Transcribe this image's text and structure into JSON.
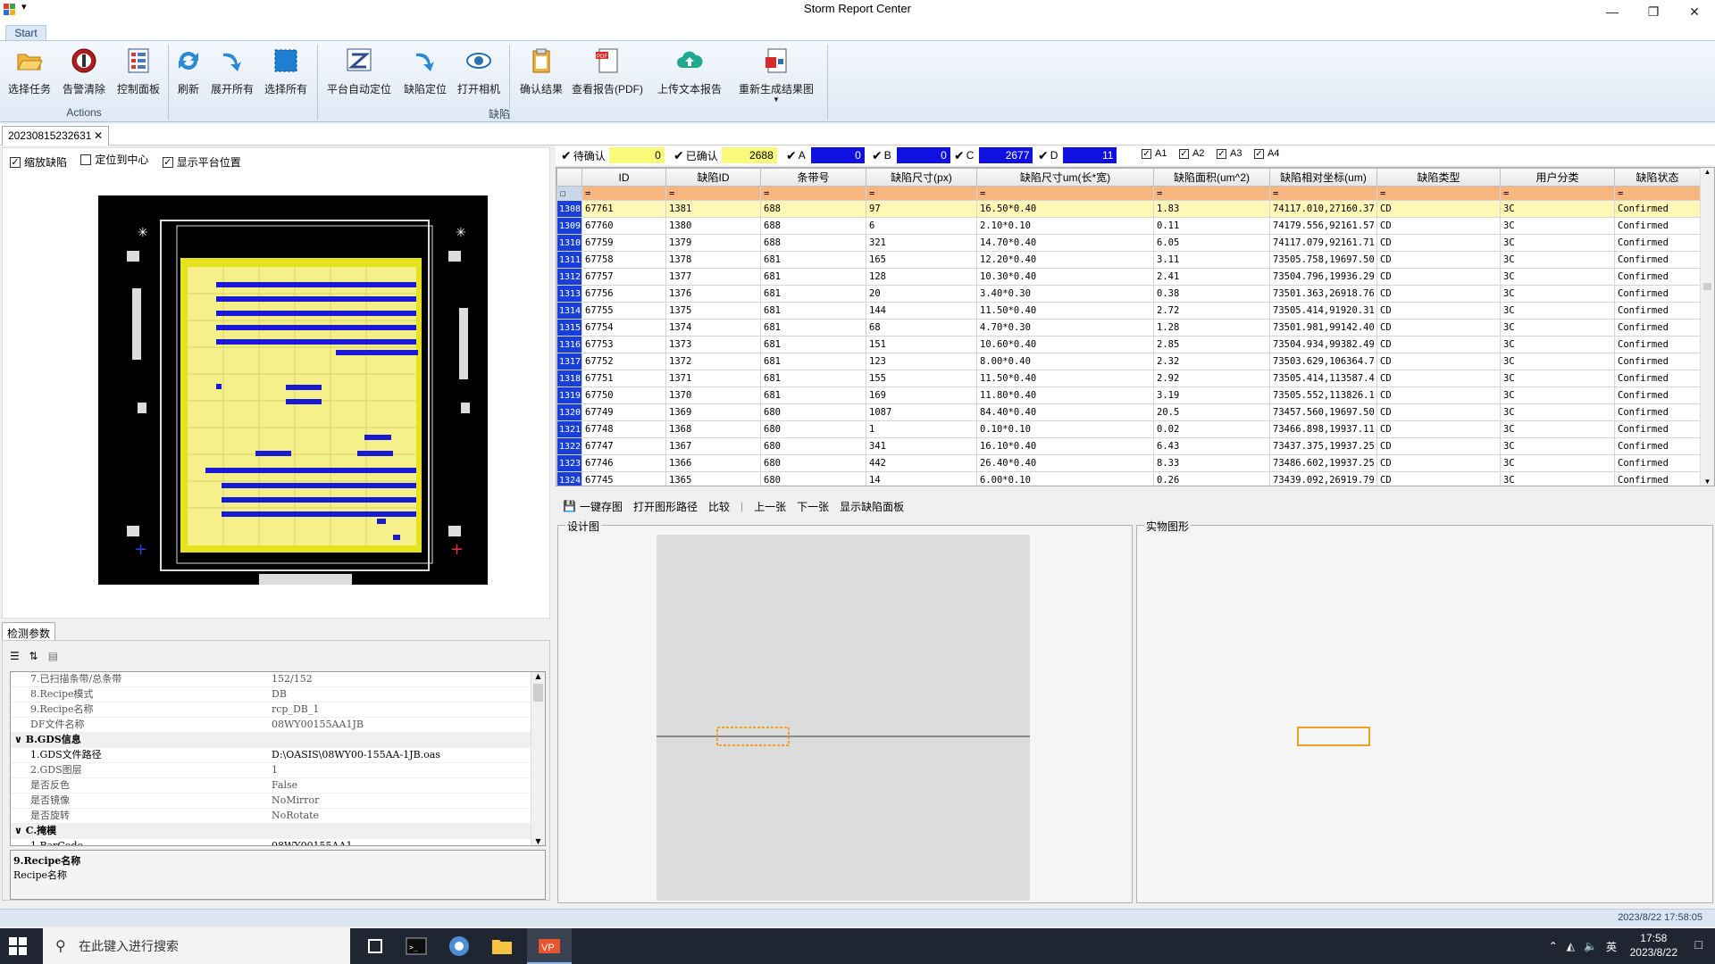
{
  "window": {
    "title": "Storm Report Center",
    "quick_access": "▾"
  },
  "ribbon": {
    "tab": "Start",
    "groups": [
      {
        "label": "Actions"
      },
      {
        "label": "缺陷"
      }
    ],
    "buttons": [
      {
        "label": "选择任务"
      },
      {
        "label": "告警清除"
      },
      {
        "label": "控制面板"
      },
      {
        "label": "刷新"
      },
      {
        "label": "展开所有"
      },
      {
        "label": "选择所有"
      },
      {
        "label": "平台自动定位"
      },
      {
        "label": "缺陷定位"
      },
      {
        "label": "打开相机"
      },
      {
        "label": "确认结果"
      },
      {
        "label": "查看报告(PDF)"
      },
      {
        "label": "上传文本报告"
      },
      {
        "label": "重新生成结果图"
      }
    ]
  },
  "doc_tab": {
    "label": "20230815232631"
  },
  "map_options": [
    {
      "label": "缩放缺陷",
      "checked": true
    },
    {
      "label": "定位到中心",
      "checked": false
    },
    {
      "label": "显示平台位置",
      "checked": true
    }
  ],
  "params": {
    "tab": "检测参数",
    "rows": [
      {
        "k": "7.已扫描条带/总条带",
        "v": "152/152",
        "type": "item"
      },
      {
        "k": "8.Recipe模式",
        "v": "DB",
        "type": "item"
      },
      {
        "k": "9.Recipe名称",
        "v": "rcp_DB_1",
        "type": "item"
      },
      {
        "k": "DF文件名称",
        "v": "08WY00155AA1JB",
        "type": "item"
      },
      {
        "k": "B.GDS信息",
        "v": "",
        "type": "cat"
      },
      {
        "k": "1.GDS文件路径",
        "v": "D:\\OASIS\\08WY00-155AA-1JB.oas",
        "type": "sel"
      },
      {
        "k": "2.GDS图层",
        "v": "1",
        "type": "item"
      },
      {
        "k": "是否反色",
        "v": "False",
        "type": "item"
      },
      {
        "k": "是否镜像",
        "v": "NoMirror",
        "type": "item"
      },
      {
        "k": "是否旋转",
        "v": "NoRotate",
        "type": "item"
      },
      {
        "k": "C.掩模",
        "v": "",
        "type": "cat"
      },
      {
        "k": "1.BarCode",
        "v": "08WY00155AA1",
        "type": "sel"
      }
    ],
    "desc_title": "9.Recipe名称",
    "desc_body": "Recipe名称"
  },
  "filters": {
    "pending_label": "待确认",
    "pending_value": "0",
    "confirmed_label": "已确认",
    "confirmed_value": "2688",
    "a_label": "A",
    "a_value": "0",
    "b_label": "B",
    "b_value": "0",
    "c_label": "C",
    "c_value": "2677",
    "d_label": "D",
    "d_value": "11",
    "small": [
      "A1",
      "A2",
      "A3",
      "A4"
    ]
  },
  "grid": {
    "columns": [
      "ID",
      "缺陷ID",
      "条带号",
      "缺陷尺寸(px)",
      "缺陷尺寸um(长*宽)",
      "缺陷面积(um^2)",
      "缺陷相对坐标(um)",
      "缺陷类型",
      "用户分类",
      "缺陷状态"
    ],
    "filter_symbol": "=",
    "rows": [
      {
        "rn": "1308",
        "c": [
          "67761",
          "1381",
          "688",
          "97",
          "16.50*0.40",
          "1.83",
          "74117.010,27160.37",
          "CD",
          "3C",
          "Confirmed"
        ]
      },
      {
        "rn": "1309",
        "c": [
          "67760",
          "1380",
          "688",
          "6",
          "2.10*0.10",
          "0.11",
          "74179.556,92161.57",
          "CD",
          "3C",
          "Confirmed"
        ]
      },
      {
        "rn": "1310",
        "c": [
          "67759",
          "1379",
          "688",
          "321",
          "14.70*0.40",
          "6.05",
          "74117.079,92161.71",
          "CD",
          "3C",
          "Confirmed"
        ]
      },
      {
        "rn": "1311",
        "c": [
          "67758",
          "1378",
          "681",
          "165",
          "12.20*0.40",
          "3.11",
          "73505.758,19697.50",
          "CD",
          "3C",
          "Confirmed"
        ]
      },
      {
        "rn": "1312",
        "c": [
          "67757",
          "1377",
          "681",
          "128",
          "10.30*0.40",
          "2.41",
          "73504.796,19936.29",
          "CD",
          "3C",
          "Confirmed"
        ]
      },
      {
        "rn": "1313",
        "c": [
          "67756",
          "1376",
          "681",
          "20",
          "3.40*0.30",
          "0.38",
          "73501.363,26918.76",
          "CD",
          "3C",
          "Confirmed"
        ]
      },
      {
        "rn": "1314",
        "c": [
          "67755",
          "1375",
          "681",
          "144",
          "11.50*0.40",
          "2.72",
          "73505.414,91920.31",
          "CD",
          "3C",
          "Confirmed"
        ]
      },
      {
        "rn": "1315",
        "c": [
          "67754",
          "1374",
          "681",
          "68",
          "4.70*0.30",
          "1.28",
          "73501.981,99142.40",
          "CD",
          "3C",
          "Confirmed"
        ]
      },
      {
        "rn": "1316",
        "c": [
          "67753",
          "1373",
          "681",
          "151",
          "10.60*0.40",
          "2.85",
          "73504.934,99382.49",
          "CD",
          "3C",
          "Confirmed"
        ]
      },
      {
        "rn": "1317",
        "c": [
          "67752",
          "1372",
          "681",
          "123",
          "8.00*0.40",
          "2.32",
          "73503.629,106364.7",
          "CD",
          "3C",
          "Confirmed"
        ]
      },
      {
        "rn": "1318",
        "c": [
          "67751",
          "1371",
          "681",
          "155",
          "11.50*0.40",
          "2.92",
          "73505.414,113587.4",
          "CD",
          "3C",
          "Confirmed"
        ]
      },
      {
        "rn": "1319",
        "c": [
          "67750",
          "1370",
          "681",
          "169",
          "11.80*0.40",
          "3.19",
          "73505.552,113826.1",
          "CD",
          "3C",
          "Confirmed"
        ]
      },
      {
        "rn": "1320",
        "c": [
          "67749",
          "1369",
          "680",
          "1087",
          "84.40*0.40",
          "20.5",
          "73457.560,19697.50",
          "CD",
          "3C",
          "Confirmed"
        ]
      },
      {
        "rn": "1321",
        "c": [
          "67748",
          "1368",
          "680",
          "1",
          "0.10*0.10",
          "0.02",
          "73466.898,19937.11",
          "CD",
          "3C",
          "Confirmed"
        ]
      },
      {
        "rn": "1322",
        "c": [
          "67747",
          "1367",
          "680",
          "341",
          "16.10*0.40",
          "6.43",
          "73437.375,19937.25",
          "CD",
          "3C",
          "Confirmed"
        ]
      },
      {
        "rn": "1323",
        "c": [
          "67746",
          "1366",
          "680",
          "442",
          "26.40*0.40",
          "8.33",
          "73486.602,19937.25",
          "CD",
          "3C",
          "Confirmed"
        ]
      },
      {
        "rn": "1324",
        "c": [
          "67745",
          "1365",
          "680",
          "14",
          "6.00*0.10",
          "0.26",
          "73439.092,26919.79",
          "CD",
          "3C",
          "Confirmed"
        ]
      }
    ]
  },
  "image_toolbar": [
    "一键存图",
    "打开图形路径",
    "比较",
    "上一张",
    "下一张",
    "显示缺陷面板"
  ],
  "design_label": "设计图",
  "actual_label": "实物图形",
  "status": {
    "datetime": "2023/8/22 17:58:05"
  },
  "taskbar": {
    "search_placeholder": "在此键入进行搜索",
    "time": "17:58",
    "date": "2023/8/22",
    "ime": "英"
  }
}
